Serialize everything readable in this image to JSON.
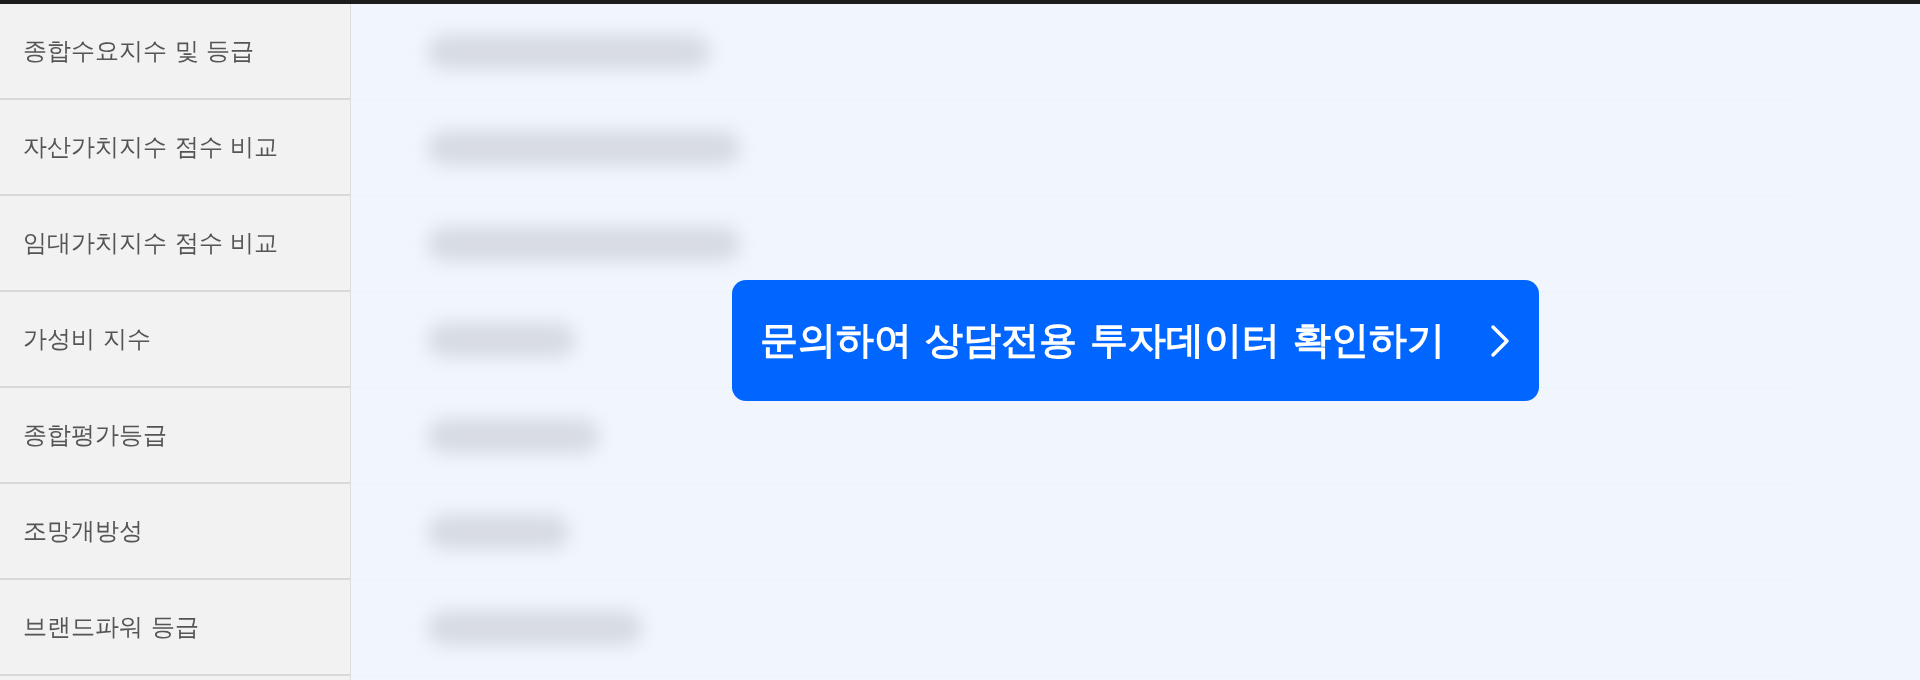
{
  "sidebar": {
    "items": [
      {
        "label": "종합수요지수 및 등급"
      },
      {
        "label": "자산가치지수 점수 비교"
      },
      {
        "label": "임대가치지수 점수 비교"
      },
      {
        "label": "가성비 지수"
      },
      {
        "label": "종합평가등급"
      },
      {
        "label": "조망개방성"
      },
      {
        "label": "브랜드파워 등급"
      }
    ]
  },
  "cta_button": {
    "label": "문의하여 상담전용 투자데이터 확인하기"
  }
}
